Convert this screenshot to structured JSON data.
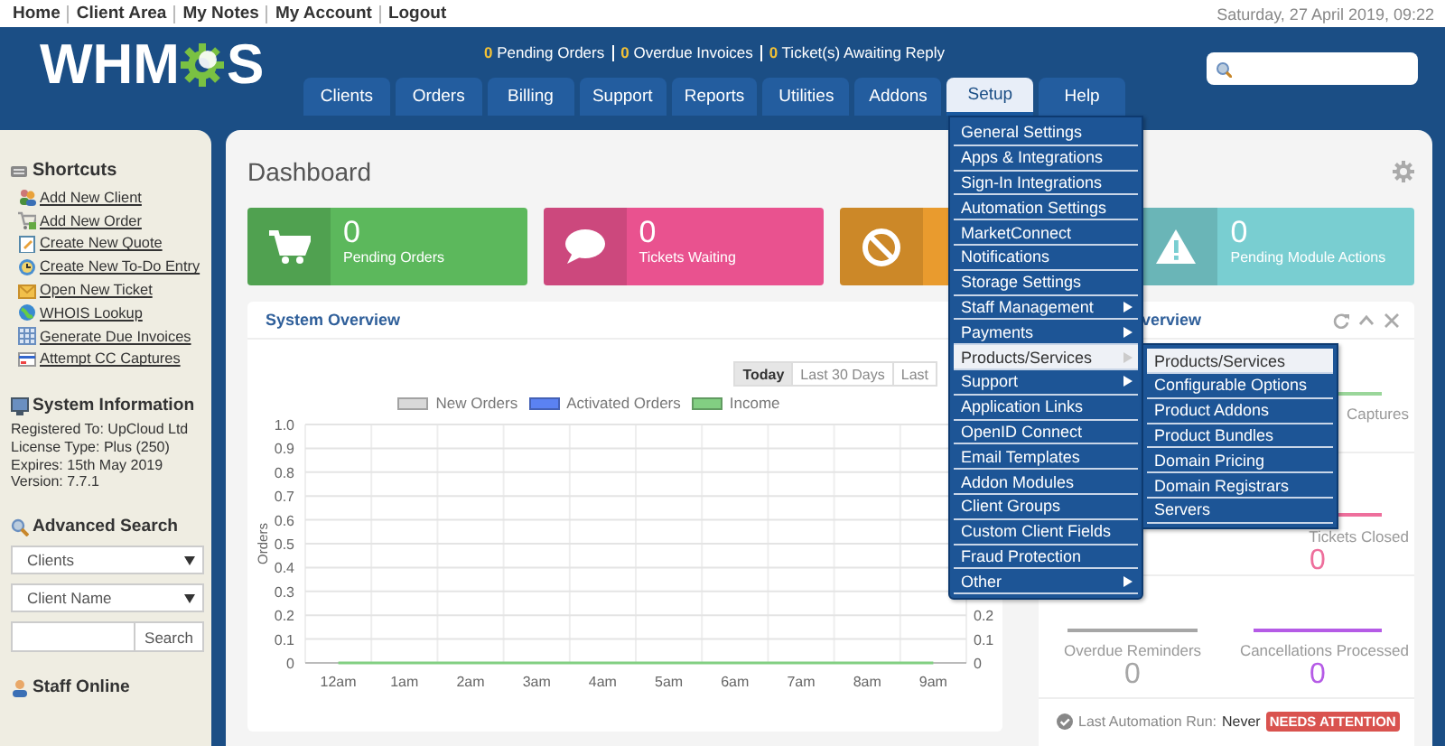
{
  "top_links": [
    "Home",
    "Client Area",
    "My Notes",
    "My Account",
    "Logout"
  ],
  "date": "Saturday, 27 April 2019, 09:22",
  "logo": {
    "left": "WHM",
    "right": "S"
  },
  "header_stats": [
    {
      "count": "0",
      "label": "Pending Orders"
    },
    {
      "count": "0",
      "label": "Overdue Invoices"
    },
    {
      "count": "0",
      "label": "Ticket(s) Awaiting Reply"
    }
  ],
  "nav": {
    "tabs": [
      {
        "label": "Clients",
        "selected": false
      },
      {
        "label": "Orders",
        "selected": false
      },
      {
        "label": "Billing",
        "selected": false
      },
      {
        "label": "Support",
        "selected": false
      },
      {
        "label": "Reports",
        "selected": false
      },
      {
        "label": "Utilities",
        "selected": false
      },
      {
        "label": "Addons",
        "selected": false
      },
      {
        "label": "Setup",
        "selected": true
      },
      {
        "label": "Help",
        "selected": false
      }
    ]
  },
  "setup_menu": {
    "items": [
      {
        "label": "General Settings",
        "submenu": false,
        "selected": false
      },
      {
        "label": "Apps & Integrations",
        "submenu": false,
        "selected": false
      },
      {
        "label": "Sign-In Integrations",
        "submenu": false,
        "selected": false
      },
      {
        "label": "Automation Settings",
        "submenu": false,
        "selected": false
      },
      {
        "label": "MarketConnect",
        "submenu": false,
        "selected": false
      },
      {
        "label": "Notifications",
        "submenu": false,
        "selected": false
      },
      {
        "label": "Storage Settings",
        "submenu": false,
        "selected": false
      },
      {
        "label": "Staff Management",
        "submenu": true,
        "selected": false
      },
      {
        "label": "Payments",
        "submenu": true,
        "selected": false
      },
      {
        "label": "Products/Services",
        "submenu": true,
        "selected": true
      },
      {
        "label": "Support",
        "submenu": true,
        "selected": false
      },
      {
        "label": "Application Links",
        "submenu": false,
        "selected": false
      },
      {
        "label": "OpenID Connect",
        "submenu": false,
        "selected": false
      },
      {
        "label": "Email Templates",
        "submenu": false,
        "selected": false
      },
      {
        "label": "Addon Modules",
        "submenu": false,
        "selected": false
      },
      {
        "label": "Client Groups",
        "submenu": false,
        "selected": false
      },
      {
        "label": "Custom Client Fields",
        "submenu": false,
        "selected": false
      },
      {
        "label": "Fraud Protection",
        "submenu": false,
        "selected": false
      },
      {
        "label": "Other",
        "submenu": true,
        "selected": false
      }
    ],
    "submenu_items": [
      {
        "label": "Products/Services",
        "selected": true
      },
      {
        "label": "Configurable Options",
        "selected": false
      },
      {
        "label": "Product Addons",
        "selected": false
      },
      {
        "label": "Product Bundles",
        "selected": false
      },
      {
        "label": "Domain Pricing",
        "selected": false
      },
      {
        "label": "Domain Registrars",
        "selected": false
      },
      {
        "label": "Servers",
        "selected": false
      }
    ]
  },
  "sidebar": {
    "shortcuts": {
      "title": "Shortcuts",
      "links": [
        "Add New Client",
        "Add New Order",
        "Create New Quote",
        "Create New To-Do Entry",
        "Open New Ticket",
        "WHOIS Lookup",
        "Generate Due Invoices",
        "Attempt CC Captures"
      ]
    },
    "system_info": {
      "title": "System Information",
      "lines": [
        "Registered To: UpCloud Ltd",
        "License Type: Plus (250)",
        "Expires: 15th May 2019",
        "Version: 7.7.1"
      ]
    },
    "advanced_search": {
      "title": "Advanced Search",
      "selects": [
        "Clients",
        "Client Name"
      ],
      "button": "Search"
    },
    "staff_online": {
      "title": "Staff Online"
    }
  },
  "dashboard": {
    "title": "Dashboard",
    "cards": [
      {
        "color": "#5cb85c",
        "count": "0",
        "label": "Pending Orders"
      },
      {
        "color": "#e9528f",
        "count": "0",
        "label": "Tickets Waiting"
      },
      {
        "color": "#e99b2e"
      },
      {
        "color": "#79ced1",
        "count": "0",
        "label": "Pending Module Actions"
      }
    ],
    "system_overview": {
      "title": "System Overview",
      "ranges": [
        {
          "label": "Today",
          "selected": true
        },
        {
          "label": "Last 30 Days",
          "selected": false
        },
        {
          "label": "Last",
          "selected": false
        }
      ],
      "chart_data": {
        "type": "line",
        "ylabel": "Orders",
        "categories": [
          "12am",
          "1am",
          "2am",
          "3am",
          "4am",
          "5am",
          "6am",
          "7am",
          "8am",
          "9am"
        ],
        "series": [
          {
            "name": "New Orders",
            "color": "#d9d9d9",
            "values": [
              null,
              null,
              null,
              null,
              null,
              null,
              null,
              null,
              null,
              null
            ]
          },
          {
            "name": "Activated Orders",
            "color": "#5b82f2",
            "values": [
              null,
              null,
              null,
              null,
              null,
              null,
              null,
              null,
              null,
              null
            ]
          },
          {
            "name": "Income",
            "color": "#82cf82",
            "values": [
              0,
              0,
              0,
              0,
              0,
              0,
              0,
              0,
              0,
              0
            ]
          }
        ],
        "ylim": [
          0,
          1
        ],
        "yticks": [
          0,
          0.1,
          0.2,
          0.3,
          0.4,
          0.5,
          0.6,
          0.7,
          0.8,
          0.9,
          {
            "value": 1,
            "label": "1.0"
          }
        ]
      },
      "right_axis_labels": [
        "0.2",
        "0.1",
        "0"
      ]
    },
    "automation_overview": {
      "title": "verview",
      "rows": [
        {
          "right": {
            "label": "Captures",
            "color": "#9ad69a"
          }
        },
        {
          "right": {
            "label": "Tickets Closed",
            "value": "0",
            "color": "#ee6f9c"
          }
        },
        {
          "left": {
            "label": "Overdue Reminders",
            "value": "0",
            "color": "#a6a6a6"
          },
          "right": {
            "label": "Cancellations Processed",
            "value": "0",
            "color": "#b55be6"
          }
        }
      ],
      "footer": {
        "label": "Last Automation Run:",
        "value": "Never",
        "badge": "NEEDS ATTENTION"
      }
    }
  }
}
